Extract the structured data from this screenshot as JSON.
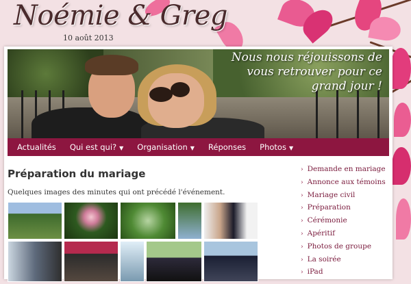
{
  "site": {
    "title": "Noémie & Greg",
    "date": "10 août 2013"
  },
  "hero": {
    "caption": "Nous nous réjouissons de vous retrouver pour ce grand jour !"
  },
  "nav": {
    "items": [
      {
        "label": "Actualités",
        "dropdown": false
      },
      {
        "label": "Qui est qui?",
        "dropdown": true
      },
      {
        "label": "Organisation",
        "dropdown": true
      },
      {
        "label": "Réponses",
        "dropdown": false
      },
      {
        "label": "Photos",
        "dropdown": true
      }
    ]
  },
  "main": {
    "title": "Préparation du mariage",
    "intro": "Quelques images des minutes qui ont précédé l'événement."
  },
  "sidebar": {
    "arrow_glyph": "›",
    "items": [
      {
        "label": "Demande en mariage"
      },
      {
        "label": "Annonce aux témoins"
      },
      {
        "label": "Mariage civil"
      },
      {
        "label": "Préparation"
      },
      {
        "label": "Cérémonie"
      },
      {
        "label": "Apéritif"
      },
      {
        "label": "Photos de groupe"
      },
      {
        "label": "La soirée"
      },
      {
        "label": "iPad"
      }
    ]
  },
  "colors": {
    "accent": "#8d1640",
    "background": "#f3e1e4",
    "blossom": "#e23c7c"
  }
}
